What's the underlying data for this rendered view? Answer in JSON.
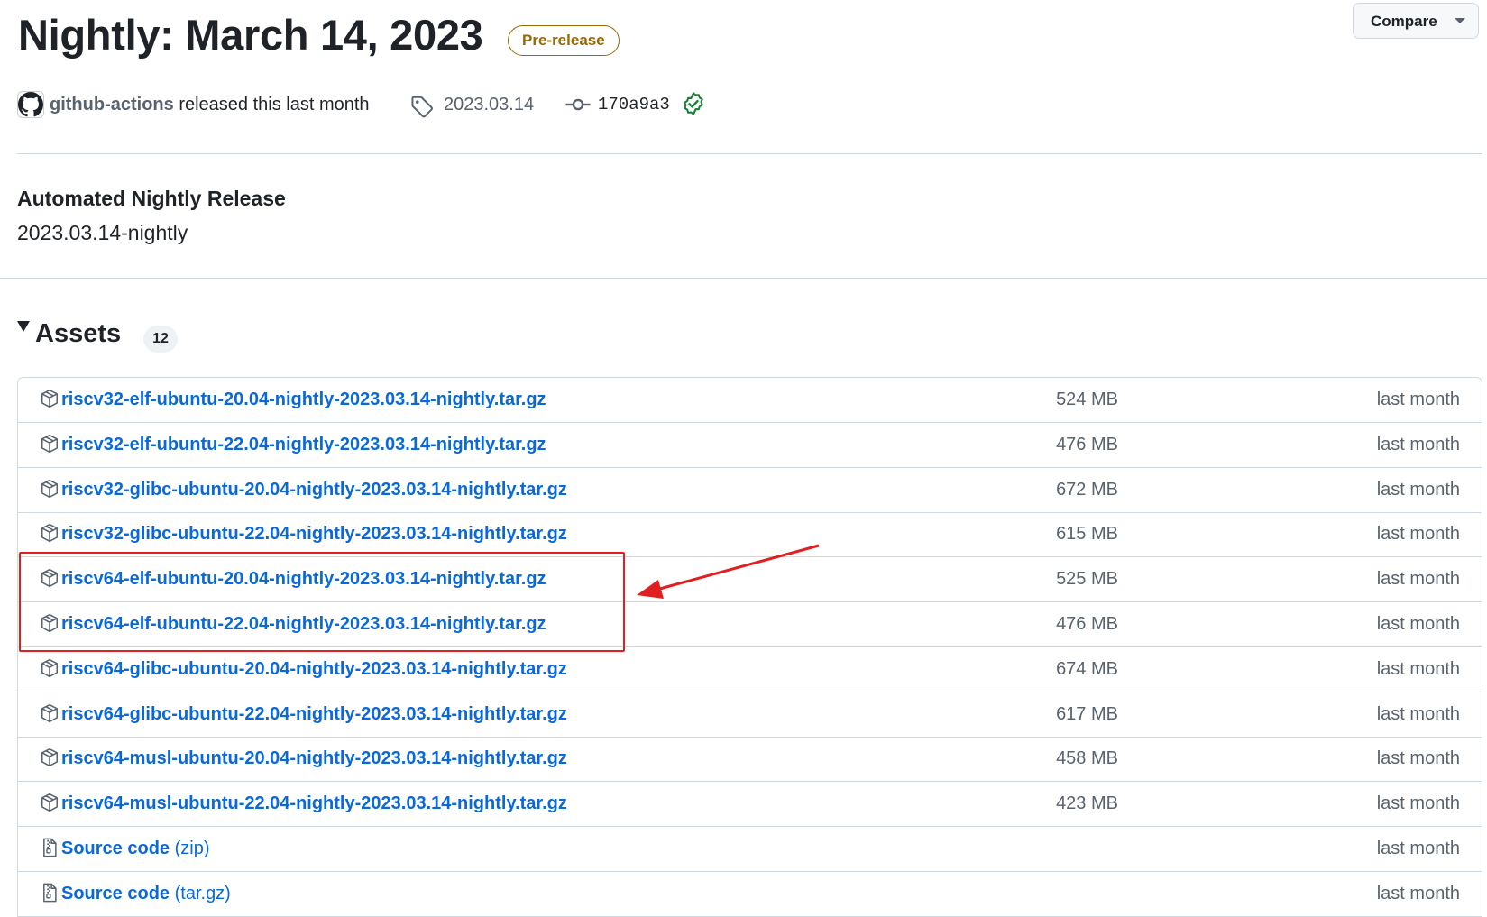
{
  "release": {
    "title": "Nightly: March 14, 2023",
    "badge": "Pre-release",
    "compare_label": "Compare",
    "author": "github-actions",
    "released_text": "released this last month",
    "tag": "2023.03.14",
    "commit": "170a9a3"
  },
  "body": {
    "heading": "Automated Nightly Release",
    "text": "2023.03.14-nightly"
  },
  "assets": {
    "title": "Assets",
    "count": "12",
    "items": [
      {
        "name": "riscv32-elf-ubuntu-20.04-nightly-2023.03.14-nightly.tar.gz",
        "size": "524 MB",
        "date": "last month"
      },
      {
        "name": "riscv32-elf-ubuntu-22.04-nightly-2023.03.14-nightly.tar.gz",
        "size": "476 MB",
        "date": "last month"
      },
      {
        "name": "riscv32-glibc-ubuntu-20.04-nightly-2023.03.14-nightly.tar.gz",
        "size": "672 MB",
        "date": "last month"
      },
      {
        "name": "riscv32-glibc-ubuntu-22.04-nightly-2023.03.14-nightly.tar.gz",
        "size": "615 MB",
        "date": "last month"
      },
      {
        "name": "riscv64-elf-ubuntu-20.04-nightly-2023.03.14-nightly.tar.gz",
        "size": "525 MB",
        "date": "last month"
      },
      {
        "name": "riscv64-elf-ubuntu-22.04-nightly-2023.03.14-nightly.tar.gz",
        "size": "476 MB",
        "date": "last month"
      },
      {
        "name": "riscv64-glibc-ubuntu-20.04-nightly-2023.03.14-nightly.tar.gz",
        "size": "674 MB",
        "date": "last month"
      },
      {
        "name": "riscv64-glibc-ubuntu-22.04-nightly-2023.03.14-nightly.tar.gz",
        "size": "617 MB",
        "date": "last month"
      },
      {
        "name": "riscv64-musl-ubuntu-20.04-nightly-2023.03.14-nightly.tar.gz",
        "size": "458 MB",
        "date": "last month"
      },
      {
        "name": "riscv64-musl-ubuntu-22.04-nightly-2023.03.14-nightly.tar.gz",
        "size": "423 MB",
        "date": "last month"
      }
    ],
    "source": [
      {
        "name": "Source code",
        "ext": "(zip)",
        "date": "last month"
      },
      {
        "name": "Source code",
        "ext": "(tar.gz)",
        "date": "last month"
      }
    ]
  },
  "colors": {
    "link": "#0969da",
    "prerelease": "#9a6700",
    "annotation": "#e02020",
    "verified": "#1a7f37"
  },
  "icons": {
    "avatar": "github-mark-icon",
    "tag": "tag-icon",
    "commit": "git-commit-icon",
    "verified": "verified-check-icon",
    "package": "package-icon",
    "archive": "file-zip-icon"
  }
}
